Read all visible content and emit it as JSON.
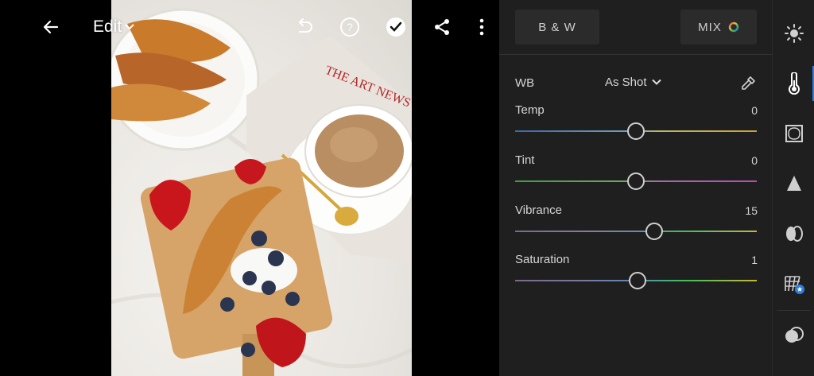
{
  "header": {
    "title": "Edit"
  },
  "photo": {
    "newspaper_text": "THE ART NEWS"
  },
  "panel": {
    "bw_label": "B & W",
    "mix_label": "MIX",
    "wb": {
      "label": "WB",
      "value": "As Shot"
    },
    "sliders": [
      {
        "label": "Temp",
        "value": "0",
        "position": 0.5
      },
      {
        "label": "Tint",
        "value": "0",
        "position": 0.5
      },
      {
        "label": "Vibrance",
        "value": "15",
        "position": 0.575
      },
      {
        "label": "Saturation",
        "value": "1",
        "position": 0.505
      }
    ]
  },
  "rail": {
    "icons": [
      "light-icon",
      "color-icon",
      "effects-icon",
      "detail-icon",
      "optics-icon",
      "geometry-icon",
      "mask-icon"
    ],
    "active": "color-icon",
    "accent": "#2d7fe0"
  }
}
